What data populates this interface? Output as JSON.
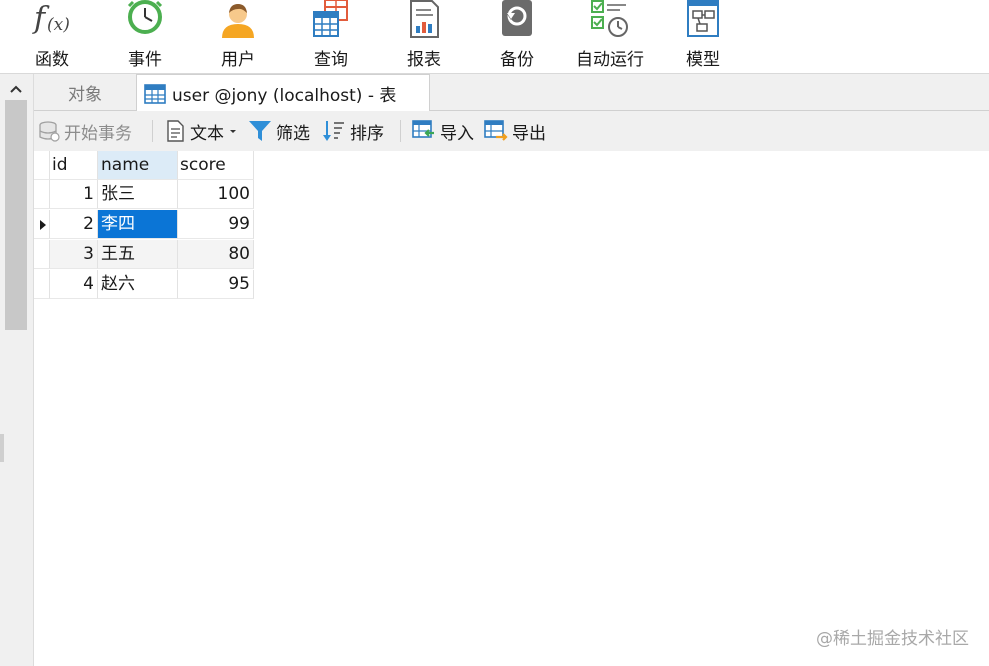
{
  "ribbon": [
    {
      "label": "函数",
      "icon": "function-icon"
    },
    {
      "label": "事件",
      "icon": "clock-icon"
    },
    {
      "label": "用户",
      "icon": "user-icon"
    },
    {
      "label": "查询",
      "icon": "query-icon"
    },
    {
      "label": "报表",
      "icon": "report-icon"
    },
    {
      "label": "备份",
      "icon": "backup-icon"
    },
    {
      "label": "自动运行",
      "icon": "automation-icon"
    },
    {
      "label": "模型",
      "icon": "model-icon"
    }
  ],
  "tabs": {
    "objects_label": "对象",
    "active_label": "user @jony (localhost) - 表"
  },
  "toolbar": {
    "begin_transaction": "开始事务",
    "text": "文本",
    "filter": "筛选",
    "sort": "排序",
    "import": "导入",
    "export": "导出"
  },
  "grid": {
    "columns": [
      "id",
      "name",
      "score"
    ],
    "rows": [
      {
        "id": "1",
        "name": "张三",
        "score": "100"
      },
      {
        "id": "2",
        "name": "李四",
        "score": "99"
      },
      {
        "id": "3",
        "name": "王五",
        "score": "80"
      },
      {
        "id": "4",
        "name": "赵六",
        "score": "95"
      }
    ],
    "selected_row": 2
  },
  "watermark": "@稀土掘金技术社区",
  "colors": {
    "selection": "#0b75d6",
    "header_highlight": "#dcebf7",
    "toolbar_bg": "#f0f0f0"
  }
}
